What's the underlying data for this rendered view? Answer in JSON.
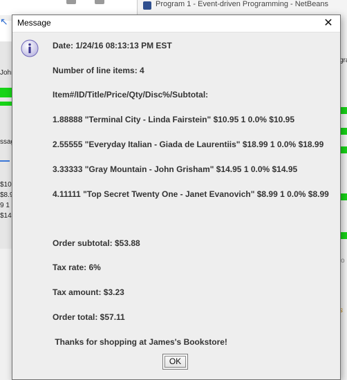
{
  "background": {
    "right_window_title": "Program 1 - Event-driven Programming - NetBeans",
    "left_fragments": [
      "John",
      "ssag",
      "$10.",
      "$8.9",
      "9 1 0",
      "$14."
    ],
    "right_fragments": [
      "gra",
      "o",
      "s"
    ],
    "colors": {
      "progress_green": "#17d417",
      "accent_blue": "#3b78d8"
    }
  },
  "dialog": {
    "title": "Message",
    "close_icon": "close-icon",
    "info_icon": "information-icon",
    "lines": {
      "date": "Date: 1/24/16 08:13:13 PM EST",
      "line_count": "Number of line items: 4",
      "header": "Item#/ID/Title/Price/Qty/Disc%/Subtotal:",
      "item1": "1.88888  \"Terminal City - Linda Fairstein\" $10.95  1 0.0% $10.95",
      "item2": "2.55555  \"Everyday Italian - Giada de Laurentiis\" $18.99  1 0.0% $18.99",
      "item3": "3.33333  \"Gray Mountain - John Grisham\" $14.95  1 0.0% $14.95",
      "item4": "4.11111  \"Top Secret Twenty One - Janet Evanovich\" $8.99  1 0.0% $8.99",
      "subtotal": "Order subtotal:  $53.88",
      "tax_rate": "Tax rate:  6%",
      "tax_amount": "Tax amount:  $3.23",
      "total": "Order total:  $57.11",
      "thanks": " Thanks for shopping at James's Bookstore!"
    },
    "ok_label": "OK"
  }
}
